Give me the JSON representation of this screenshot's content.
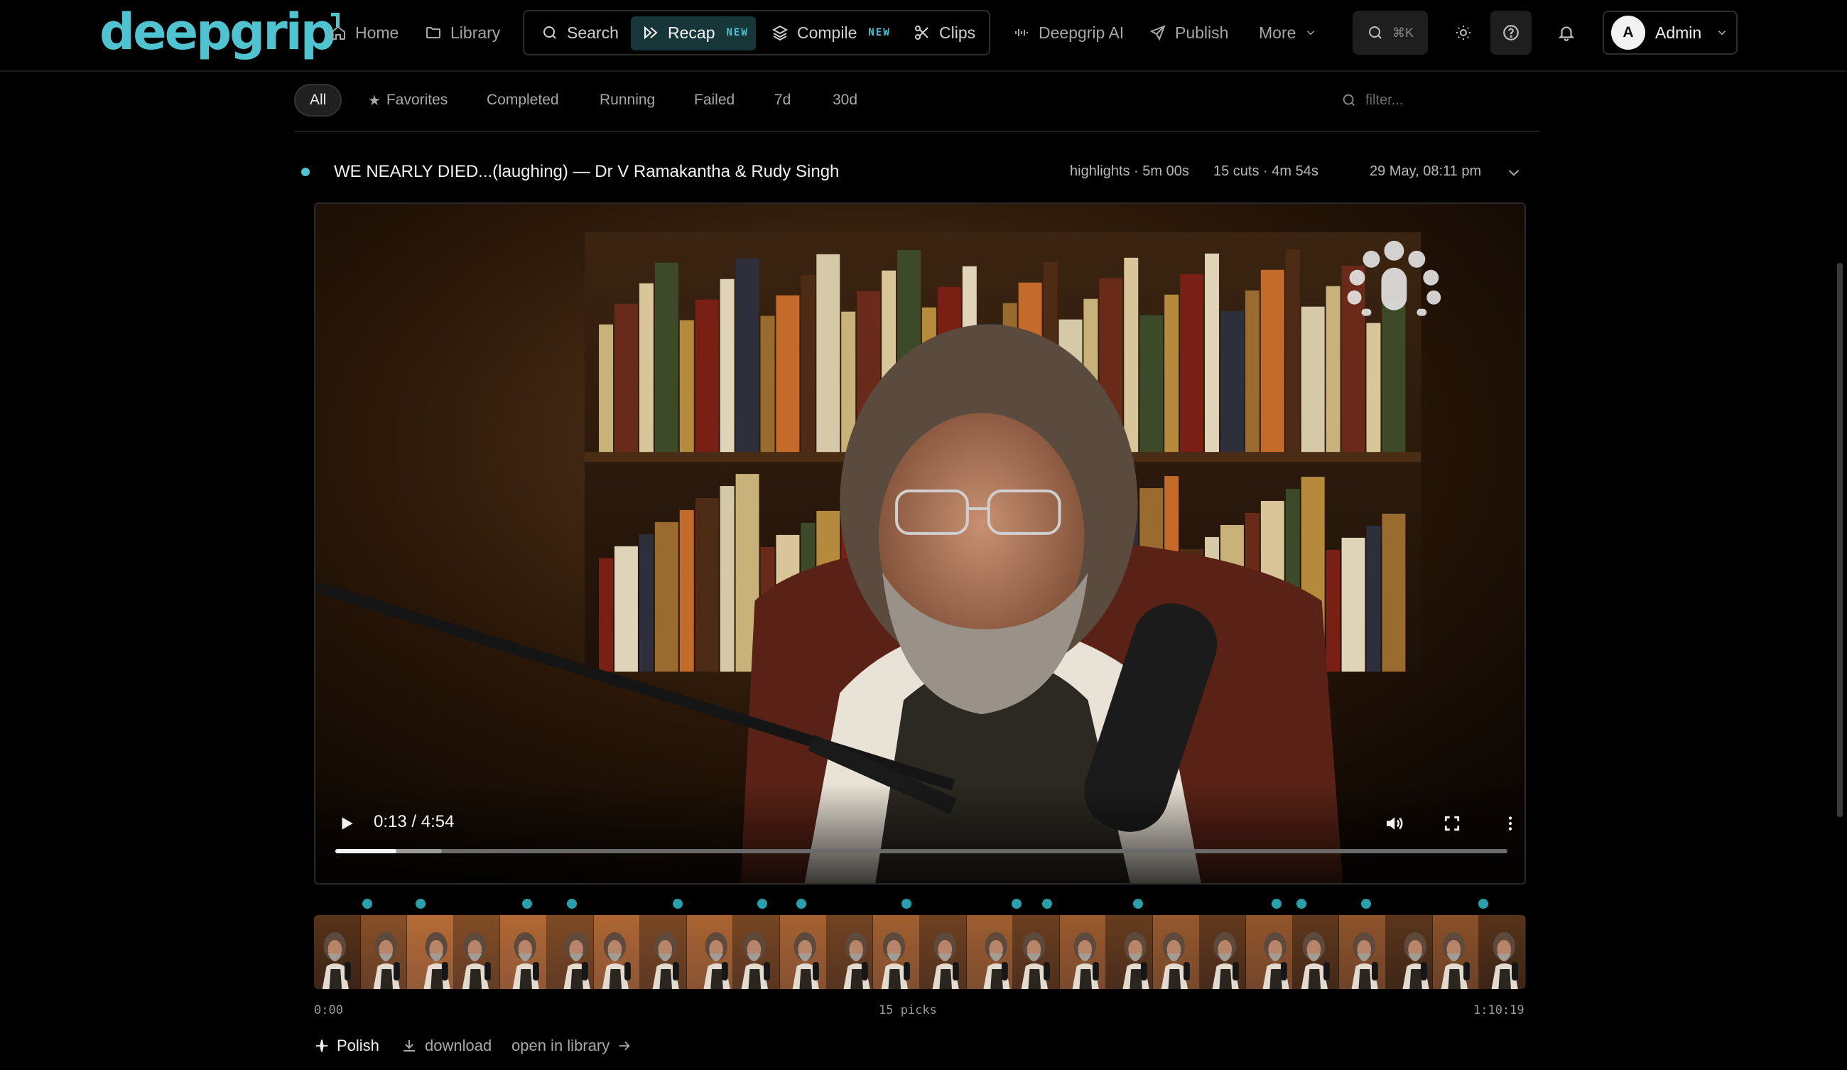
{
  "app": {
    "logo_text": "deepgrip",
    "accent_color": "#4fc3cf"
  },
  "nav": {
    "home": "Home",
    "library": "Library",
    "search": "Search",
    "recap": "Recap",
    "recap_badge": "NEW",
    "compile": "Compile",
    "compile_badge": "NEW",
    "clips": "Clips",
    "ai": "Deepgrip AI",
    "publish": "Publish",
    "more": "More",
    "shortcut": "⌘K",
    "user_initial": "A",
    "user_name": "Admin"
  },
  "filters": {
    "chips": [
      "All",
      "Favorites",
      "Completed",
      "Running",
      "Failed",
      "7d",
      "30d"
    ],
    "active": "All",
    "placeholder": "filter..."
  },
  "job": {
    "title": "WE NEARLY DIED...(laughing) — Dr V Ramakantha & Rudy Singh",
    "mode": "highlights · 5m 00s",
    "cuts": "15 cuts · 4m 54s",
    "date": "29 May, 08:11 pm",
    "status": "completed"
  },
  "player": {
    "timecode": "0:13 / 4:54",
    "played_fraction": 0.052,
    "buffered_fraction": 0.091
  },
  "timeline": {
    "start": "0:00",
    "picks_label": "15 picks",
    "end": "1:10:19",
    "pick_positions": [
      0.044,
      0.088,
      0.176,
      0.213,
      0.3,
      0.37,
      0.402,
      0.489,
      0.58,
      0.605,
      0.68,
      0.794,
      0.815,
      0.868,
      0.965
    ],
    "frame_count": 26
  },
  "actions": {
    "polish": "Polish",
    "download": "download",
    "open_library": "open in library"
  }
}
